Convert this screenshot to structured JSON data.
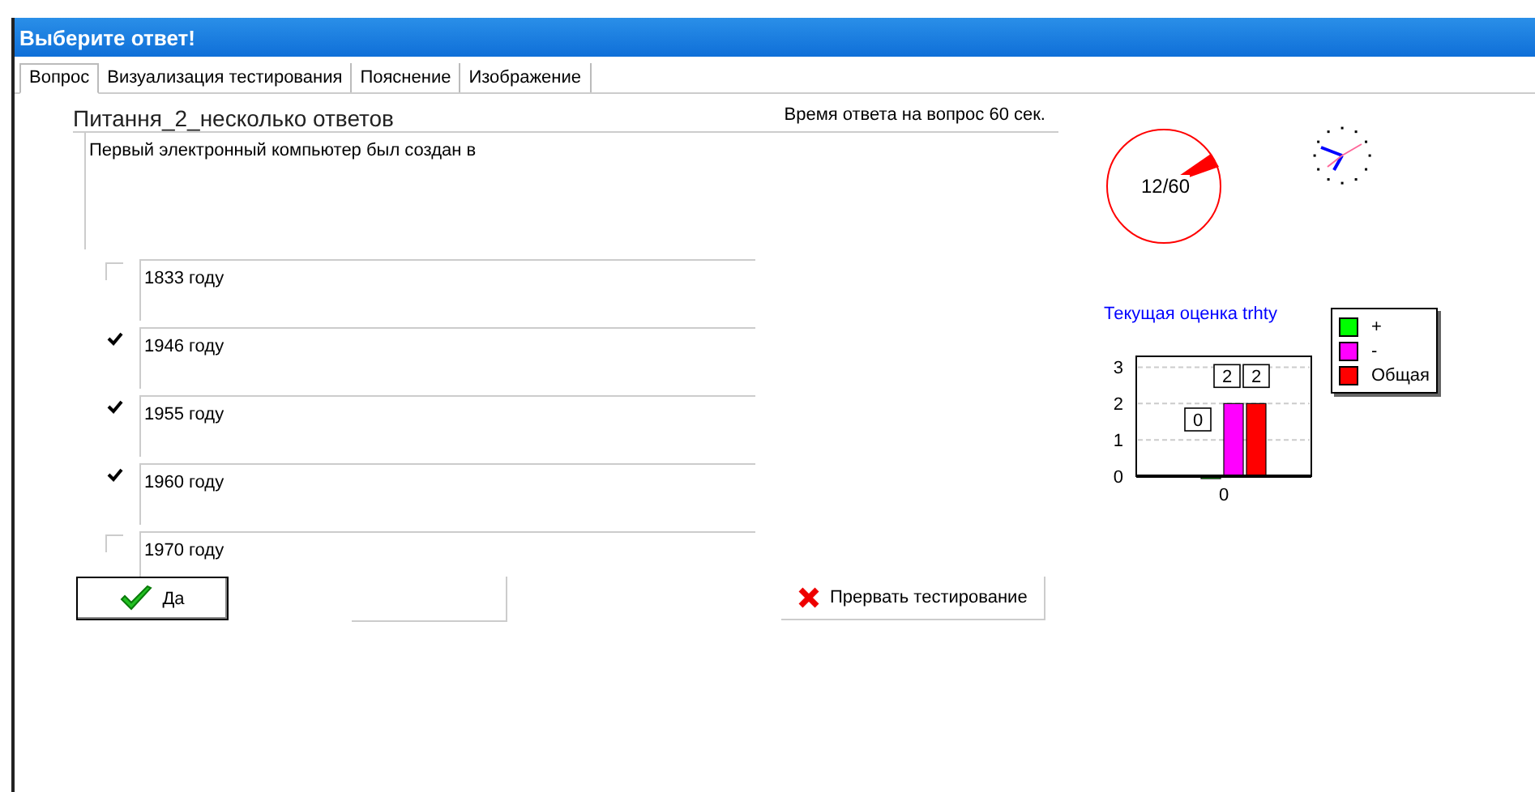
{
  "window": {
    "title": "Выберите ответ!"
  },
  "tabs": [
    {
      "label": "Вопрос",
      "selected": true
    },
    {
      "label": "Визуализация тестирования",
      "selected": false
    },
    {
      "label": "Пояснение",
      "selected": false
    },
    {
      "label": "Изображение",
      "selected": false
    }
  ],
  "question": {
    "title": "Питання_2_несколько ответов",
    "time_limit": "Время ответа на вопрос 60 сек.",
    "text": "Первый электронный компьютер был создан в"
  },
  "answers": [
    {
      "label": "1833 году",
      "checked": false
    },
    {
      "label": "1946 году",
      "checked": true
    },
    {
      "label": "1955 году",
      "checked": true
    },
    {
      "label": "1960 году",
      "checked": true
    },
    {
      "label": "1970 году",
      "checked": false
    }
  ],
  "confirm_button": "Да",
  "abort_button": "Прервать тестирование",
  "timer": {
    "reading": "12/60"
  },
  "score_chart": {
    "chart_data": {
      "type": "bar",
      "title": "Текущая оценка trhty",
      "categories": [
        "0"
      ],
      "series": [
        {
          "name": "+",
          "color": "#00ff00",
          "values": [
            0
          ]
        },
        {
          "name": "-",
          "color": "#ff00ff",
          "values": [
            2
          ]
        },
        {
          "name": "Общая",
          "color": "#ff0000",
          "values": [
            2
          ]
        }
      ],
      "yticks": [
        0,
        1,
        2,
        3
      ],
      "ylim": [
        0,
        3.3
      ],
      "grid": true,
      "data_labels": true
    }
  }
}
